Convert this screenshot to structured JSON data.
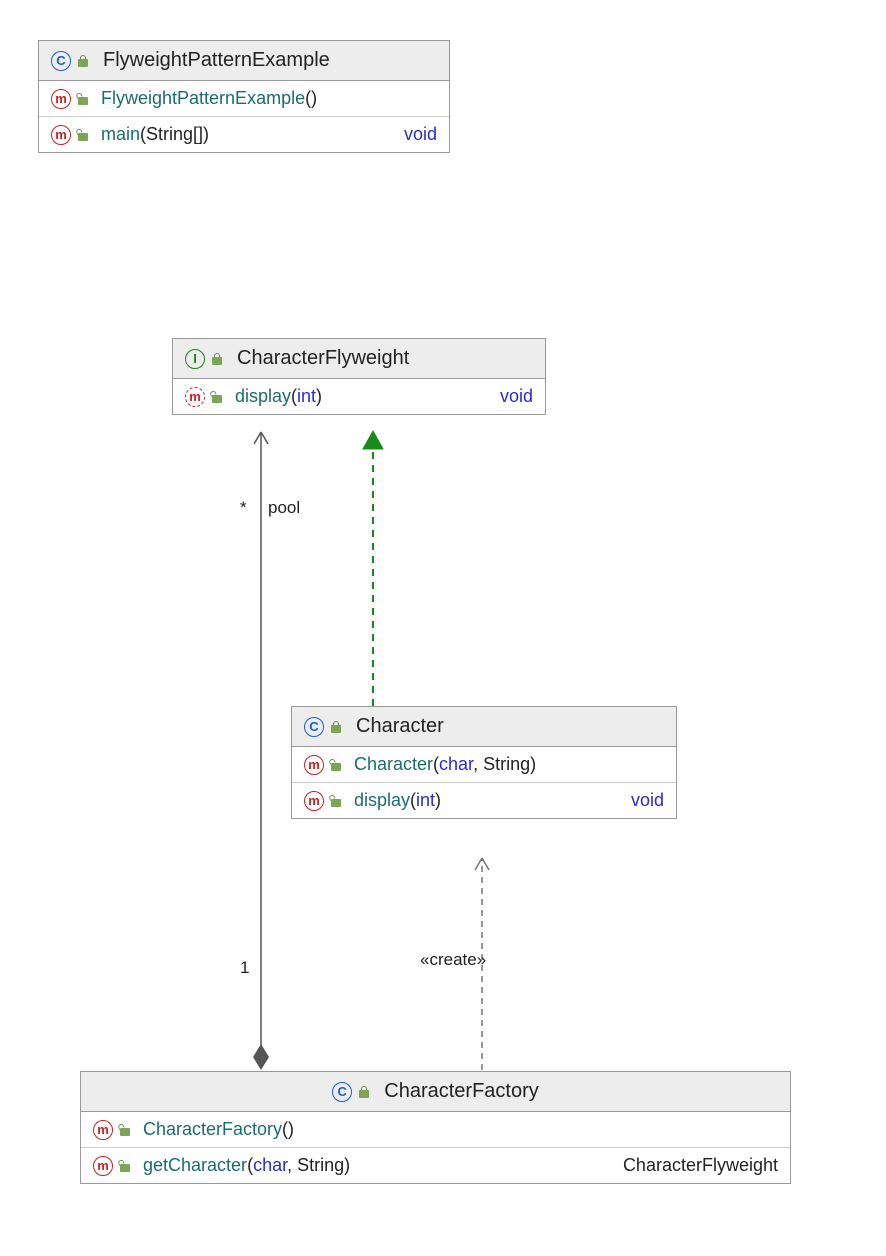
{
  "classes": {
    "flyweight_example": {
      "kind": "C",
      "title": "FlyweightPatternExample",
      "members": [
        {
          "icon": "m",
          "abstract": false,
          "name": "FlyweightPatternExample",
          "params_open": "(",
          "params": "",
          "params_close": ")",
          "ret": ""
        },
        {
          "icon": "m",
          "abstract": false,
          "name": "main",
          "params_open": "(",
          "params": "String[]",
          "params_close": ")",
          "ret": "void"
        }
      ]
    },
    "character_flyweight": {
      "kind": "I",
      "title": "CharacterFlyweight",
      "members": [
        {
          "icon": "m",
          "abstract": true,
          "name": "display",
          "params_open": "(",
          "params": "int",
          "params_close": ")",
          "ret": "void"
        }
      ]
    },
    "character": {
      "kind": "C",
      "title": "Character",
      "members": [
        {
          "icon": "m",
          "abstract": false,
          "name": "Character",
          "params_open": "(",
          "params": "char, String",
          "params_close": ")",
          "ret": ""
        },
        {
          "icon": "m",
          "abstract": false,
          "name": "display",
          "params_open": "(",
          "params": "int",
          "params_close": ")",
          "ret": "void"
        }
      ]
    },
    "character_factory": {
      "kind": "C",
      "title": "CharacterFactory",
      "members": [
        {
          "icon": "m",
          "abstract": false,
          "name": "CharacterFactory",
          "params_open": "(",
          "params": "",
          "params_close": ")",
          "ret": ""
        },
        {
          "icon": "m",
          "abstract": false,
          "name": "getCharacter",
          "params_open": "(",
          "params": "char, String",
          "params_close": ")",
          "ret": "CharacterFlyweight"
        }
      ]
    }
  },
  "labels": {
    "pool_mult_top": "*",
    "pool_name": "pool",
    "pool_mult_bottom": "1",
    "create": "«create»"
  },
  "relationships": [
    {
      "from": "CharacterFactory",
      "to": "CharacterFlyweight",
      "type": "composition",
      "role": "pool",
      "multiplicity_source": "1",
      "multiplicity_target": "*"
    },
    {
      "from": "Character",
      "to": "CharacterFlyweight",
      "type": "realization"
    },
    {
      "from": "CharacterFactory",
      "to": "Character",
      "type": "dependency",
      "stereotype": "«create»"
    }
  ]
}
